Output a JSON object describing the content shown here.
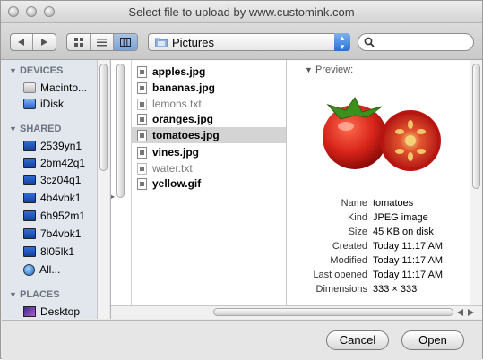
{
  "window": {
    "title": "Select file to upload by www.customink.com"
  },
  "toolbar": {
    "location": "Pictures",
    "view_modes": [
      "icon-view",
      "list-view",
      "column-view"
    ],
    "active_view": "column-view",
    "search_placeholder": ""
  },
  "sidebar": {
    "devices_header": "DEVICES",
    "devices": [
      "Macinto...",
      "iDisk"
    ],
    "shared_header": "SHARED",
    "shared": [
      "2539yn1",
      "2bm42q1",
      "3cz04q1",
      "4b4vbk1",
      "6h952m1",
      "7b4vbk1",
      "8l05lk1",
      "All..."
    ],
    "places_header": "PLACES",
    "places": [
      "Desktop"
    ]
  },
  "files": [
    {
      "name": "apples.jpg",
      "enabled": true
    },
    {
      "name": "bananas.jpg",
      "enabled": true
    },
    {
      "name": "lemons.txt",
      "enabled": false
    },
    {
      "name": "oranges.jpg",
      "enabled": true
    },
    {
      "name": "tomatoes.jpg",
      "enabled": true,
      "selected": true
    },
    {
      "name": "vines.jpg",
      "enabled": true
    },
    {
      "name": "water.txt",
      "enabled": false
    },
    {
      "name": "yellow.gif",
      "enabled": true
    }
  ],
  "preview": {
    "label": "Preview:",
    "meta": [
      {
        "key": "Name",
        "value": "tomatoes"
      },
      {
        "key": "Kind",
        "value": "JPEG image"
      },
      {
        "key": "Size",
        "value": "45 KB on disk"
      },
      {
        "key": "Created",
        "value": "Today 11:17 AM"
      },
      {
        "key": "Modified",
        "value": "Today 11:17 AM"
      },
      {
        "key": "Last opened",
        "value": "Today 11:17 AM"
      },
      {
        "key": "Dimensions",
        "value": "333 × 333"
      }
    ]
  },
  "buttons": {
    "cancel": "Cancel",
    "open": "Open"
  }
}
